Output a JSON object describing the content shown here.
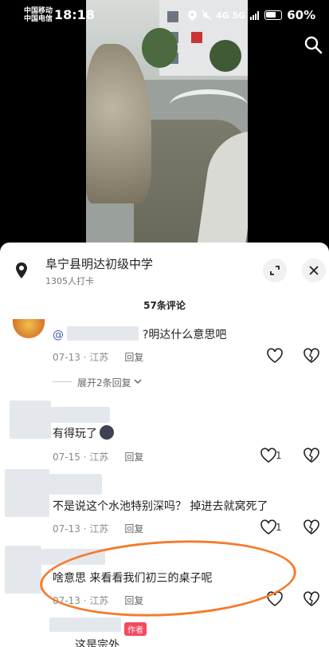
{
  "status_bar": {
    "carrier1": "中国移动",
    "carrier2": "中国电信",
    "time": "18:18",
    "network": "4G 5G",
    "battery": "60%"
  },
  "location": {
    "name": "阜宁县明达初级中学",
    "checkins": "1305人打卡"
  },
  "comments_header": "57条评论",
  "comments": [
    {
      "text": "?明达什么意思吧",
      "mention": "@",
      "meta_date": "07-13 · 江苏",
      "reply": "回复",
      "likes": ""
    },
    {
      "text": "有得玩了",
      "meta_date": "07-15 · 江苏",
      "reply": "回复",
      "likes": "1"
    },
    {
      "text": "不是说这个水池特别深吗？ 掉进去就窝死了",
      "meta_date": "07-13 · 江苏",
      "reply": "回复",
      "likes": "1"
    },
    {
      "text": "啥意思 来看看我们初三的桌子呢",
      "meta_date": "07-13 · 江苏",
      "reply": "回复",
      "likes": ""
    },
    {
      "text": "这是宗外",
      "author_tag": "作者"
    }
  ],
  "expand_replies": "展开2条回复",
  "colors": {
    "accent": "#f34a5f",
    "annotation": "#f47b2c"
  }
}
